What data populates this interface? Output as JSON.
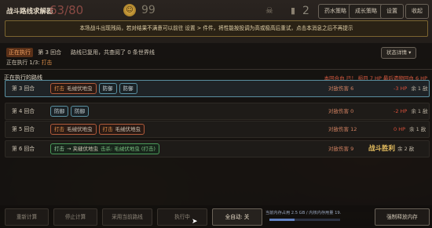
{
  "hud": {
    "title": "战斗路线求解器",
    "hp": "63/80",
    "gold": "99",
    "level": "2",
    "buttons": [
      "药水策略",
      "成长策略",
      "设置",
      "收起"
    ]
  },
  "notice": "本场战斗出现残局，若对结果不满意可以前往 设置 > 件件，将性能按投调为高或极高后重试，点击本消息之后不再提示",
  "execution": {
    "badge": "正在执行",
    "round": "第 3 回合",
    "message": "路线已复用，共查阅了 0 条世界线",
    "state_button": "状态详情",
    "progress_prefix": "正在执行 1/3:",
    "progress_action": "打击"
  },
  "section": {
    "title": "正在执行的路线",
    "stats_red": "本回合血 已！ 损目 7 HP 最后遗物回血 6 HP"
  },
  "rounds": [
    {
      "label": "第 3 回合",
      "active": true,
      "pills": [
        {
          "kind": "atk",
          "text": "打击",
          "sub": "毛绒伏地虫"
        },
        {
          "kind": "def",
          "text": "防御"
        },
        {
          "kind": "def",
          "text": "防御"
        }
      ],
      "dmg": "对敌伤害 6",
      "hp": "-3 HP",
      "remain": "余 1 敌"
    },
    {
      "label": "第 4 回合",
      "active": false,
      "pills": [
        {
          "kind": "def",
          "text": "防御"
        },
        {
          "kind": "def",
          "text": "防御"
        }
      ],
      "dmg": "对敌伤害 0",
      "hp": "-2 HP",
      "remain": "余 1 敌"
    },
    {
      "label": "第 5 回合",
      "active": false,
      "pills": [
        {
          "kind": "atk",
          "text": "打击",
          "sub": "毛绒伏地虫"
        },
        {
          "kind": "atk",
          "text": "打击",
          "sub": "毛绒伏地虫"
        }
      ],
      "dmg": "对敌伤害 12",
      "hp": "0 HP",
      "remain": "余 1 敌"
    },
    {
      "label": "第 6 回合",
      "active": false,
      "pills": [
        {
          "kind": "item",
          "text": "打击",
          "sub": "→ 夹缝伏地虫",
          "extra": "击杀: 毛绒伏地虫 (打击)"
        }
      ],
      "dmg": "对敌伤害 9",
      "victory": "战斗胜利",
      "remain": "余 2 敌"
    }
  ],
  "bottom": {
    "buttons": [
      "重新计算",
      "停止计算",
      "采用当前路线",
      "执行中",
      "全自动: 关"
    ],
    "memory": "当前内存占用 2.5 GB / 内核内存用量 19.4 GB",
    "memory_fraction": 0.35,
    "clear_button": "强制释放内存"
  }
}
